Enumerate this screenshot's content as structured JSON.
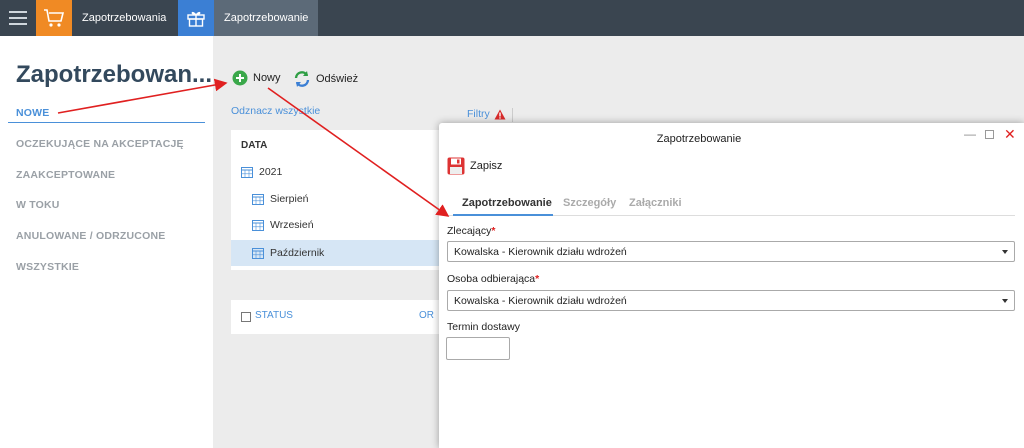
{
  "topbar": {
    "tabs": [
      {
        "label": "Zapotrzebowania",
        "icon": "cart-icon",
        "color": "#f08a24"
      },
      {
        "label": "Zapotrzebowanie",
        "icon": "gift-icon",
        "color": "#3b7fd4"
      }
    ]
  },
  "sidebar": {
    "title": "Zapotrzebowan...",
    "items": [
      {
        "label": "NOWE",
        "active": true
      },
      {
        "label": "OCZEKUJĄCE NA AKCEPTACJĘ"
      },
      {
        "label": "ZAAKCEPTOWANE"
      },
      {
        "label": "W TOKU"
      },
      {
        "label": "ANULOWANE / ODRZUCONE"
      },
      {
        "label": "WSZYSTKIE"
      }
    ]
  },
  "toolbar": {
    "new_label": "Nowy",
    "refresh_label": "Odśwież",
    "deselect_all": "Odznacz wszystkie",
    "filters": "Filtry"
  },
  "tree": {
    "header": "DATA",
    "rows": [
      {
        "label": "2021"
      },
      {
        "label": "Sierpień"
      },
      {
        "label": "Wrzesień"
      },
      {
        "label": "Październik",
        "selected": true
      }
    ]
  },
  "status_panel": {
    "status": "STATUS",
    "or": "OR"
  },
  "dialog": {
    "title": "Zapotrzebowanie",
    "save_label": "Zapisz",
    "tabs": [
      {
        "label": "Zapotrzebowanie",
        "active": true
      },
      {
        "label": "Szczegóły"
      },
      {
        "label": "Załączniki"
      }
    ],
    "fields": {
      "zlecajacy_label": "Zlecający",
      "zlecajacy_value": "Kowalska - Kierownik działu wdrożeń",
      "osoba_label": "Osoba odbierająca",
      "osoba_value": "Kowalska - Kierownik działu wdrożeń",
      "termin_label": "Termin dostawy",
      "termin_value": ""
    },
    "required_mark": "*"
  },
  "colors": {
    "accent": "#4a90d9",
    "topbar": "#3a4550",
    "annotation": "#e02020"
  }
}
